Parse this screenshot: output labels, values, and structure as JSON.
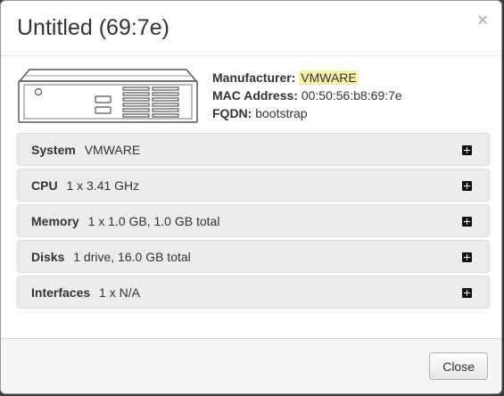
{
  "header": {
    "title": "Untitled (69:7e)",
    "close_glyph": "×"
  },
  "summary": {
    "manufacturer_label": "Manufacturer:",
    "manufacturer_value": "VMWARE",
    "mac_label": "MAC Address:",
    "mac_value": "00:50:56:b8:69:7e",
    "fqdn_label": "FQDN:",
    "fqdn_value": "bootstrap",
    "image_icon": "rack-server-icon"
  },
  "panels": [
    {
      "label": "System",
      "value": "VMWARE",
      "icon": "plus-square-icon"
    },
    {
      "label": "CPU",
      "value": "1 x 3.41 GHz",
      "icon": "plus-square-icon"
    },
    {
      "label": "Memory",
      "value": "1 x 1.0 GB, 1.0 GB total",
      "icon": "plus-square-icon"
    },
    {
      "label": "Disks",
      "value": "1 drive, 16.0 GB total",
      "icon": "plus-square-icon"
    },
    {
      "label": "Interfaces",
      "value": "1 x N/A",
      "icon": "plus-square-icon"
    }
  ],
  "footer": {
    "close_label": "Close"
  },
  "colors": {
    "highlight": "#fcf0a8",
    "panel_bg": "#ececec",
    "footer_bg": "#f5f5f5"
  }
}
